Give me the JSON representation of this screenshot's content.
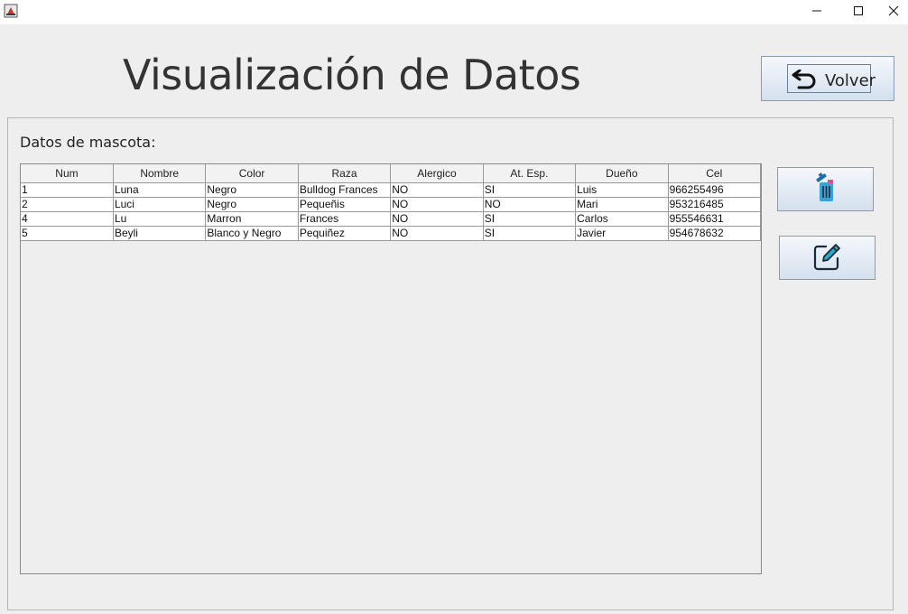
{
  "window": {
    "minimize_glyph": "—",
    "maximize_glyph": "☐",
    "close_glyph": "✕"
  },
  "header": {
    "title": "Visualización de Datos",
    "back_label": "Volver"
  },
  "panel": {
    "label": "Datos de mascota:"
  },
  "table": {
    "columns": [
      "Num",
      "Nombre",
      "Color",
      "Raza",
      "Alergico",
      "At. Esp.",
      "Dueño",
      "Cel"
    ],
    "rows": [
      [
        "1",
        "Luna",
        "Negro",
        "Bulldog Frances",
        "NO",
        "SI",
        "Luis",
        "966255496"
      ],
      [
        "2",
        "Luci",
        "Negro",
        "Pequeñis",
        "NO",
        "NO",
        "Mari",
        "953216485"
      ],
      [
        "4",
        "Lu",
        "Marron",
        "Frances",
        "NO",
        "SI",
        "Carlos",
        "955546631"
      ],
      [
        "5",
        "Beyli",
        "Blanco y Negro",
        "Pequiñez",
        "NO",
        "SI",
        "Javier",
        "954678632"
      ]
    ]
  },
  "icons": {
    "back": "undo-arrow-icon",
    "delete": "trash-icon",
    "edit": "edit-pencil-icon",
    "app": "java-app-icon"
  },
  "colors": {
    "button_top": "#f5f8fc",
    "button_bottom": "#d4e0ee",
    "trash_body": "#3aa3d6",
    "pencil": "#2aa9c9"
  }
}
